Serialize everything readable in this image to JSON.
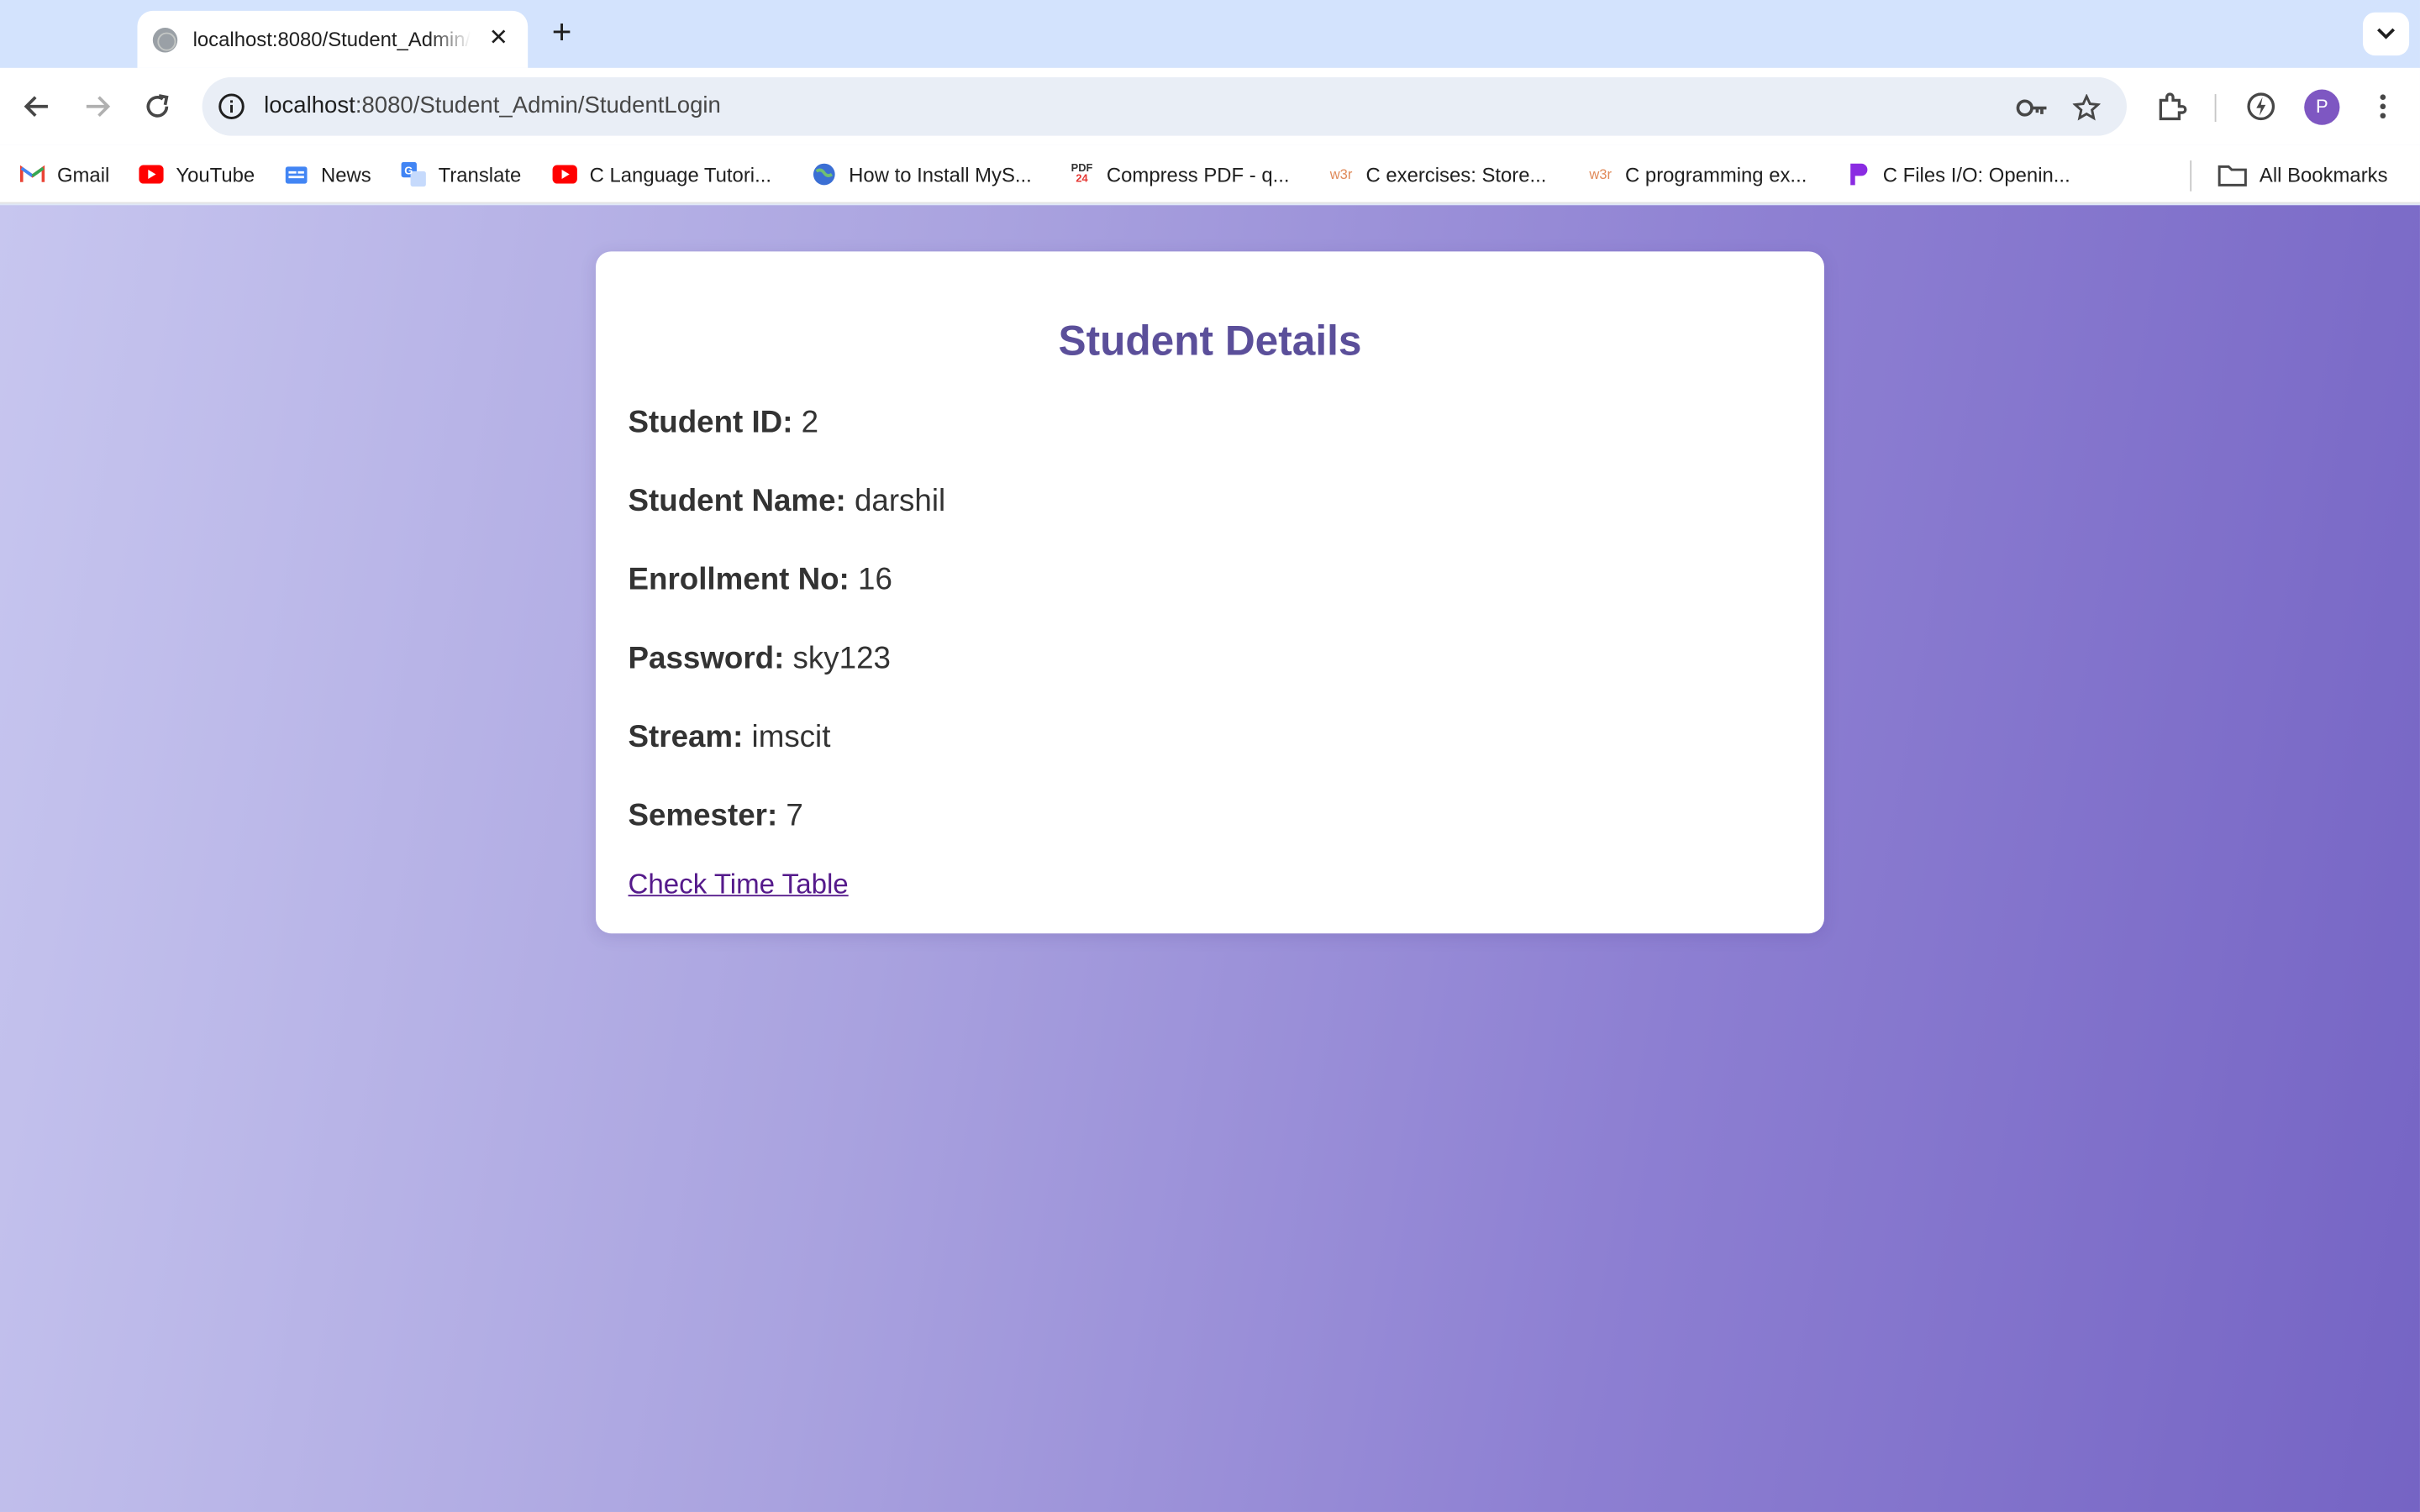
{
  "browser": {
    "tab_title": "localhost:8080/Student_Admin/StudentLogin",
    "new_tab_symbol": "+",
    "close_symbol": "✕",
    "url_host": "localhost",
    "url_rest": ":8080/Student_Admin/StudentLogin",
    "avatar_letter": "P"
  },
  "bookmarks": [
    {
      "label": "Gmail",
      "icon": "gmail-icon"
    },
    {
      "label": "YouTube",
      "icon": "youtube-icon"
    },
    {
      "label": "News",
      "icon": "google-news-icon"
    },
    {
      "label": "Translate",
      "icon": "translate-icon"
    },
    {
      "label": "C Language Tutori...",
      "icon": "youtube-icon"
    },
    {
      "label": "How to Install MyS...",
      "icon": "globe-icon"
    },
    {
      "label": "Compress PDF - q...",
      "icon": "pdf24-icon"
    },
    {
      "label": "C exercises: Store...",
      "icon": "w3resource-icon"
    },
    {
      "label": "C programming ex...",
      "icon": "w3resource-icon"
    },
    {
      "label": "C Files I/O: Openin...",
      "icon": "programiz-icon"
    }
  ],
  "all_bookmarks_label": "All Bookmarks",
  "card": {
    "title": "Student Details",
    "fields": [
      {
        "label": "Student ID:",
        "value": "2"
      },
      {
        "label": "Student Name:",
        "value": "darshil"
      },
      {
        "label": "Enrollment No:",
        "value": "16"
      },
      {
        "label": "Password:",
        "value": "sky123"
      },
      {
        "label": "Stream:",
        "value": "imscit"
      },
      {
        "label": "Semester:",
        "value": "7"
      }
    ],
    "link_text": "Check Time Table"
  },
  "colors": {
    "title": "#5b4f9a",
    "link": "#551a8b",
    "gradient_start": "#c7c6ef",
    "gradient_end": "#7564c4"
  }
}
